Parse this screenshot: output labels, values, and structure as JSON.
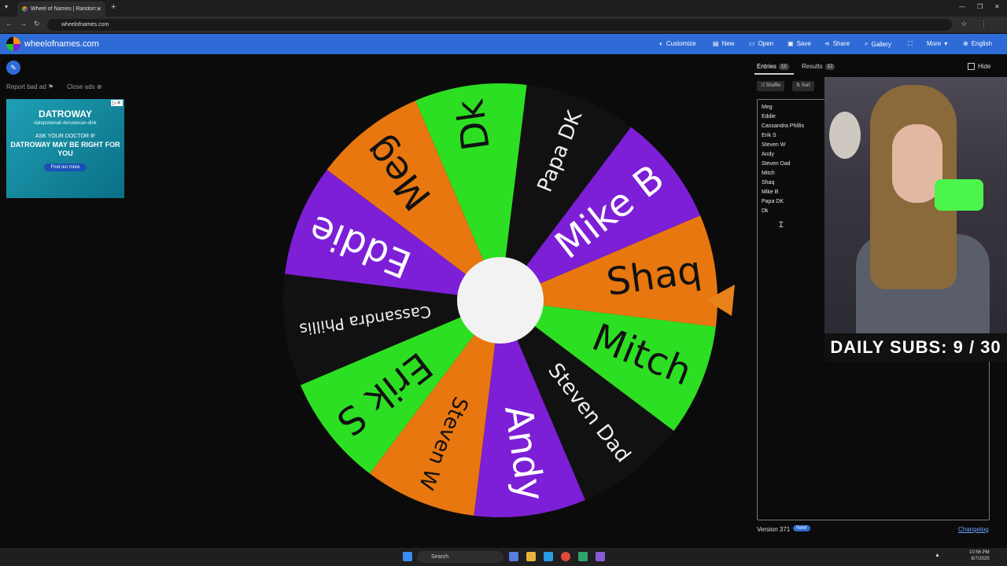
{
  "browser": {
    "tab_title": "Wheel of Names | Random nam",
    "url": "wheelofnames.com"
  },
  "app": {
    "site_name": "wheelofnames.com",
    "menu": [
      {
        "label": "Customize",
        "icon": "palette-icon"
      },
      {
        "label": "New",
        "icon": "new-file-icon"
      },
      {
        "label": "Open",
        "icon": "folder-icon"
      },
      {
        "label": "Save",
        "icon": "save-icon"
      },
      {
        "label": "Share",
        "icon": "share-icon"
      },
      {
        "label": "Gallery",
        "icon": "search-icon"
      },
      {
        "label": "More",
        "icon": "chevron-down-icon"
      },
      {
        "label": "English",
        "icon": "globe-icon"
      }
    ]
  },
  "ad": {
    "report_label": "Report bad ad",
    "close_label": "Close ads",
    "brand": "DATROWAY",
    "drug_name": "datopotamab deruxtecan-dlnk",
    "line1": "ASK YOUR DOCTOR IF",
    "line2": "DATROWAY MAY BE RIGHT FOR YOU",
    "cta": "Find out more"
  },
  "wheel": {
    "segments": [
      {
        "label": "Shaq",
        "color": "#e8770f",
        "text": "#111111"
      },
      {
        "label": "Mitch",
        "color": "#2ddf23",
        "text": "#111111"
      },
      {
        "label": "Steven Dad",
        "color": "#111111",
        "text": "#eeeeee"
      },
      {
        "label": "Andy",
        "color": "#7c1fd6",
        "text": "#ffffff"
      },
      {
        "label": "Steven W",
        "color": "#e8770f",
        "text": "#111111"
      },
      {
        "label": "Erik S",
        "color": "#2ddf23",
        "text": "#111111"
      },
      {
        "label": "Cassandra Phillis",
        "color": "#111111",
        "text": "#eeeeee"
      },
      {
        "label": "Eddie",
        "color": "#7c1fd6",
        "text": "#ffffff"
      },
      {
        "label": "Meg",
        "color": "#e8770f",
        "text": "#111111"
      },
      {
        "label": "Dk",
        "color": "#2ddf23",
        "text": "#111111"
      },
      {
        "label": "Papa DK",
        "color": "#111111",
        "text": "#eeeeee"
      },
      {
        "label": "Mike B",
        "color": "#7c1fd6",
        "text": "#ffffff"
      }
    ],
    "pointer_color": "#e8821a"
  },
  "panel": {
    "entries_tab": "Entries",
    "entries_count": "12",
    "results_tab": "Results",
    "results_count": "12",
    "hide_label": "Hide",
    "shuffle_label": "Shuffle",
    "sort_label": "Sort",
    "entries": [
      "Meg",
      "Eddie",
      "Cassandra Phillis",
      "Erik S",
      "Steven W",
      "Andy",
      "Steven Dad",
      "Mitch",
      "Shaq",
      "Mike B",
      "Papa DK",
      "Dk"
    ],
    "version": "Version 371",
    "new_badge": "New!",
    "changelog": "Changelog"
  },
  "overlay": {
    "subs_text": "DAILY SUBS:  9 / 30"
  },
  "taskbar": {
    "search_label": "Search",
    "time": "10:56 PM",
    "date": "8/7/2025"
  }
}
